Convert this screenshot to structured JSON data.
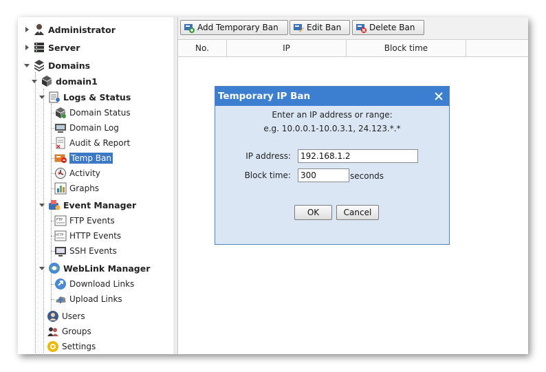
{
  "sidebar": {
    "administrator": "Administrator",
    "server": "Server",
    "domains": "Domains",
    "domain1": "domain1",
    "logs_status": "Logs & Status",
    "domain_status": "Domain Status",
    "domain_log": "Domain Log",
    "audit_report": "Audit & Report",
    "temp_ban": "Temp Ban",
    "activity": "Activity",
    "graphs": "Graphs",
    "event_manager": "Event Manager",
    "ftp_events": "FTP Events",
    "http_events": "HTTP Events",
    "ssh_events": "SSH Events",
    "weblink_manager": "WebLink Manager",
    "download_links": "Download Links",
    "upload_links": "Upload Links",
    "users": "Users",
    "groups": "Groups",
    "settings": "Settings"
  },
  "toolbar": {
    "add_label": "Add Temporary Ban",
    "edit_label": "Edit Ban",
    "delete_label": "Delete Ban"
  },
  "table": {
    "columns": [
      "No.",
      "IP",
      "Block time"
    ]
  },
  "dialog": {
    "title": "Temporary IP Ban",
    "instruction": "Enter an IP address or range:",
    "example": "e.g. 10.0.0.1-10.0.3.1, 24.123.*.*",
    "ip_label": "IP address:",
    "ip_value": "192.168.1.2",
    "block_label": "Block time:",
    "block_value": "300",
    "block_unit": "seconds",
    "ok_label": "OK",
    "cancel_label": "Cancel"
  },
  "colors": {
    "dialog_title_bg": "#3c7fd0",
    "dialog_bg": "#dbe6f4",
    "selection": "#3b78c6"
  }
}
